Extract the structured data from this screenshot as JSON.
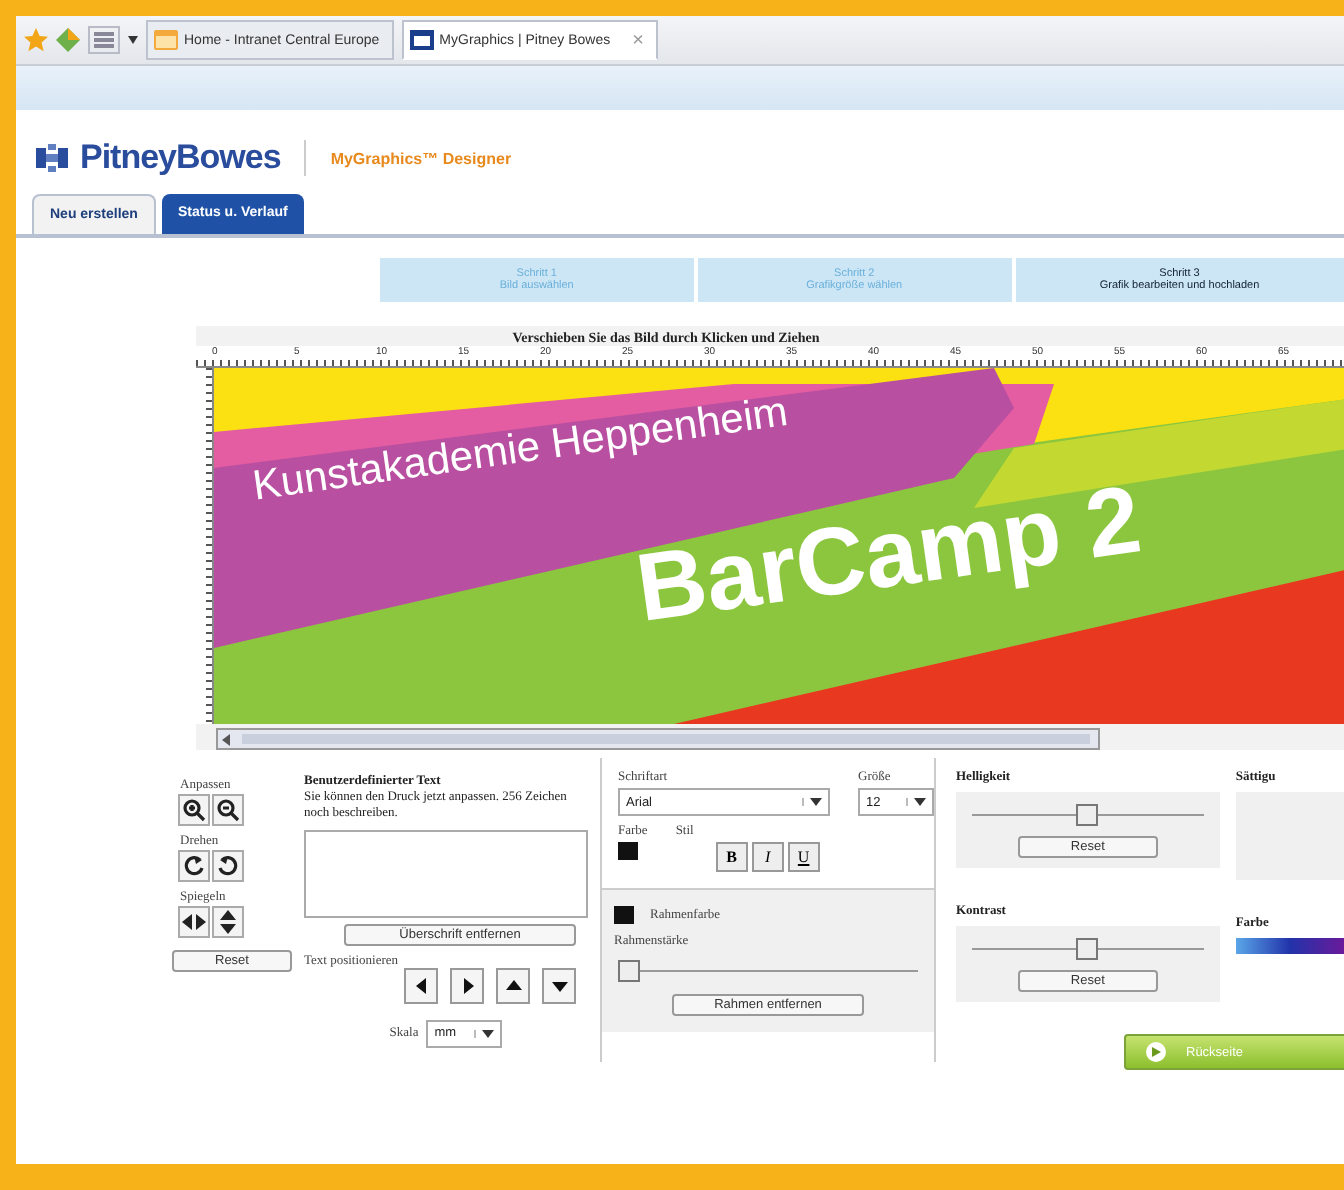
{
  "browser": {
    "tabs": [
      {
        "label": "Home - Intranet Central Europe",
        "selected": false
      },
      {
        "label": "MyGraphics | Pitney Bowes",
        "selected": true,
        "close": "×"
      }
    ]
  },
  "header": {
    "brand": "PitneyBowes",
    "product": "MyGraphics™ Designer"
  },
  "tabs": [
    {
      "label": "Neu erstellen",
      "selected": true
    },
    {
      "label": "Status u. Verlauf",
      "selected": false
    }
  ],
  "steps": [
    {
      "number": "Schritt 1",
      "label": "Bild auswählen",
      "selected": false
    },
    {
      "number": "Schritt 2",
      "label": "Grafikgröße wählen",
      "selected": false
    },
    {
      "number": "Schritt 3",
      "label": "Grafik bearbeiten und hochladen",
      "selected": true
    }
  ],
  "canvas": {
    "hint": "Verschieben Sie das Bild durch Klicken und Ziehen",
    "ruler": [
      "0",
      "5",
      "10",
      "15",
      "20",
      "25",
      "30",
      "35",
      "40",
      "45",
      "50",
      "55",
      "60",
      "65"
    ],
    "banner": {
      "subtitle": "Kunstakademie Heppenheim",
      "title": "BarCamp 2"
    }
  },
  "transform": {
    "groups": [
      {
        "label": "Anpassen",
        "kind": "zoom"
      },
      {
        "label": "Drehen",
        "kind": "rotate"
      },
      {
        "label": "Spiegeln",
        "kind": "flip"
      }
    ],
    "reset": "Reset"
  },
  "text": {
    "title": "Benutzerdefinierter Text",
    "description": "Sie können den Druck jetzt anpassen. 256 Zeichen noch beschreiben.",
    "remove": "Überschrift entfernen",
    "position_label": "Text positionieren",
    "scale_label": "Skala",
    "scale_value": "mm"
  },
  "font": {
    "family_label": "Schriftart",
    "family": "Arial",
    "size_label": "Größe",
    "size": "12",
    "color_label": "Farbe",
    "style_label": "Stil",
    "styles": [
      "B",
      "I",
      "U"
    ],
    "border_color_label": "Rahmenfarbe",
    "border_width": {
      "label": "Rahmenstärke",
      "level": 0
    },
    "remove_border": "Rahmen entfernen"
  },
  "adjust": [
    {
      "label": "Helligkeit",
      "level": 0.5,
      "reset": "Reset"
    },
    {
      "label": "Kontrast",
      "level": 0.5,
      "reset": "Reset"
    }
  ],
  "extra": {
    "saturation_label": "Sättigu",
    "color_label": "Farbe"
  },
  "next_button": "Rückseite"
}
